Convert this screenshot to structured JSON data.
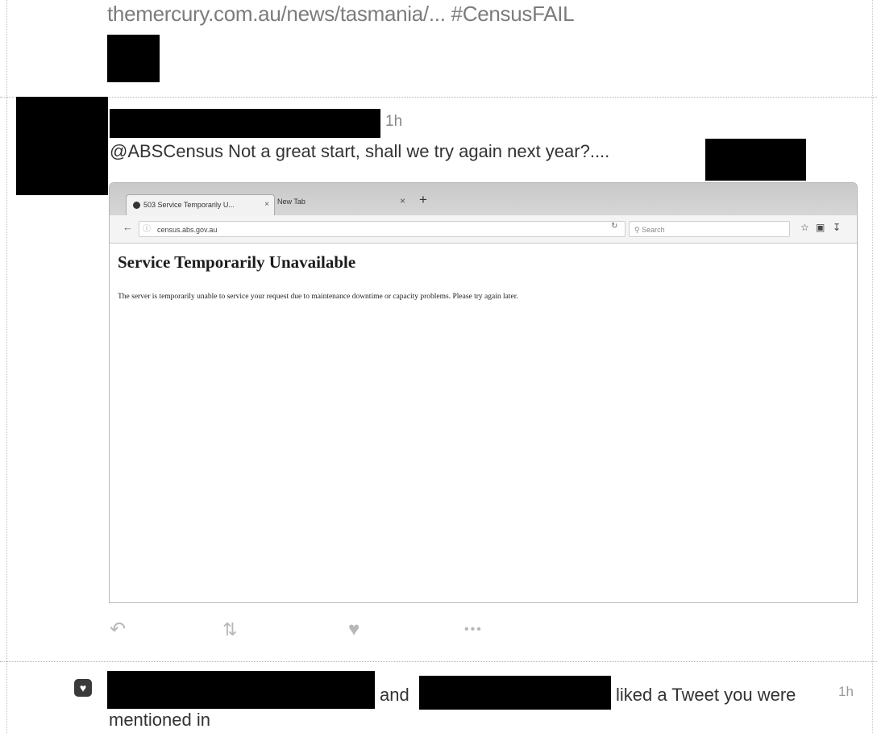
{
  "previous_tweet": {
    "text": "themercury.com.au/news/tasmania/... #CensusFAIL"
  },
  "tweet": {
    "time": "1h",
    "text": "@ABSCensus Not a great start, shall we try again next year?....",
    "embedded_screenshot": {
      "tabs": [
        {
          "label": "503 Service Temporarily U...",
          "close": "×"
        },
        {
          "label": "New Tab",
          "close": "×"
        }
      ],
      "new_tab": "+",
      "url": "census.abs.gov.au",
      "search_placeholder": "Search",
      "heading": "Service Temporarily Unavailable",
      "body": "The server is temporarily unable to service your request due to maintenance downtime or capacity problems. Please try again later."
    },
    "actions": {
      "reply_icon": "reply-icon",
      "retweet_icon": "retweet-icon",
      "like_icon": "heart-icon",
      "more_icon": "more-icon"
    }
  },
  "notification": {
    "icon": "heart-icon",
    "conjunction": "and",
    "text_line1": "liked a Tweet you were",
    "text_line2": "mentioned in",
    "time": "1h"
  }
}
